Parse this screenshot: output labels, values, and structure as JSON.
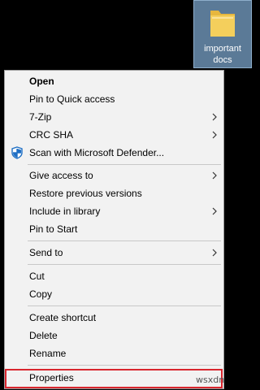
{
  "desktop": {
    "file": {
      "name_line1": "important",
      "name_line2": "docs",
      "icon": "folder-icon"
    }
  },
  "menu": {
    "items": [
      {
        "label": "Open",
        "bold": true
      },
      {
        "label": "Pin to Quick access"
      },
      {
        "label": "7-Zip",
        "submenu": true
      },
      {
        "label": "CRC SHA",
        "submenu": true
      },
      {
        "label": "Scan with Microsoft Defender...",
        "icon": "defender-shield-icon"
      },
      {
        "label": "Give access to",
        "submenu": true
      },
      {
        "label": "Restore previous versions"
      },
      {
        "label": "Include in library",
        "submenu": true
      },
      {
        "label": "Pin to Start"
      },
      {
        "label": "Send to",
        "submenu": true
      },
      {
        "label": "Cut"
      },
      {
        "label": "Copy"
      },
      {
        "label": "Create shortcut"
      },
      {
        "label": "Delete"
      },
      {
        "label": "Rename"
      },
      {
        "label": "Properties"
      }
    ]
  },
  "watermark": "wsxdn",
  "colors": {
    "menu_background": "#f2f2f2",
    "highlight_border": "#d9262e",
    "selection_tile": "#5b7a97",
    "folder_yellow": "#f4cf5c"
  }
}
